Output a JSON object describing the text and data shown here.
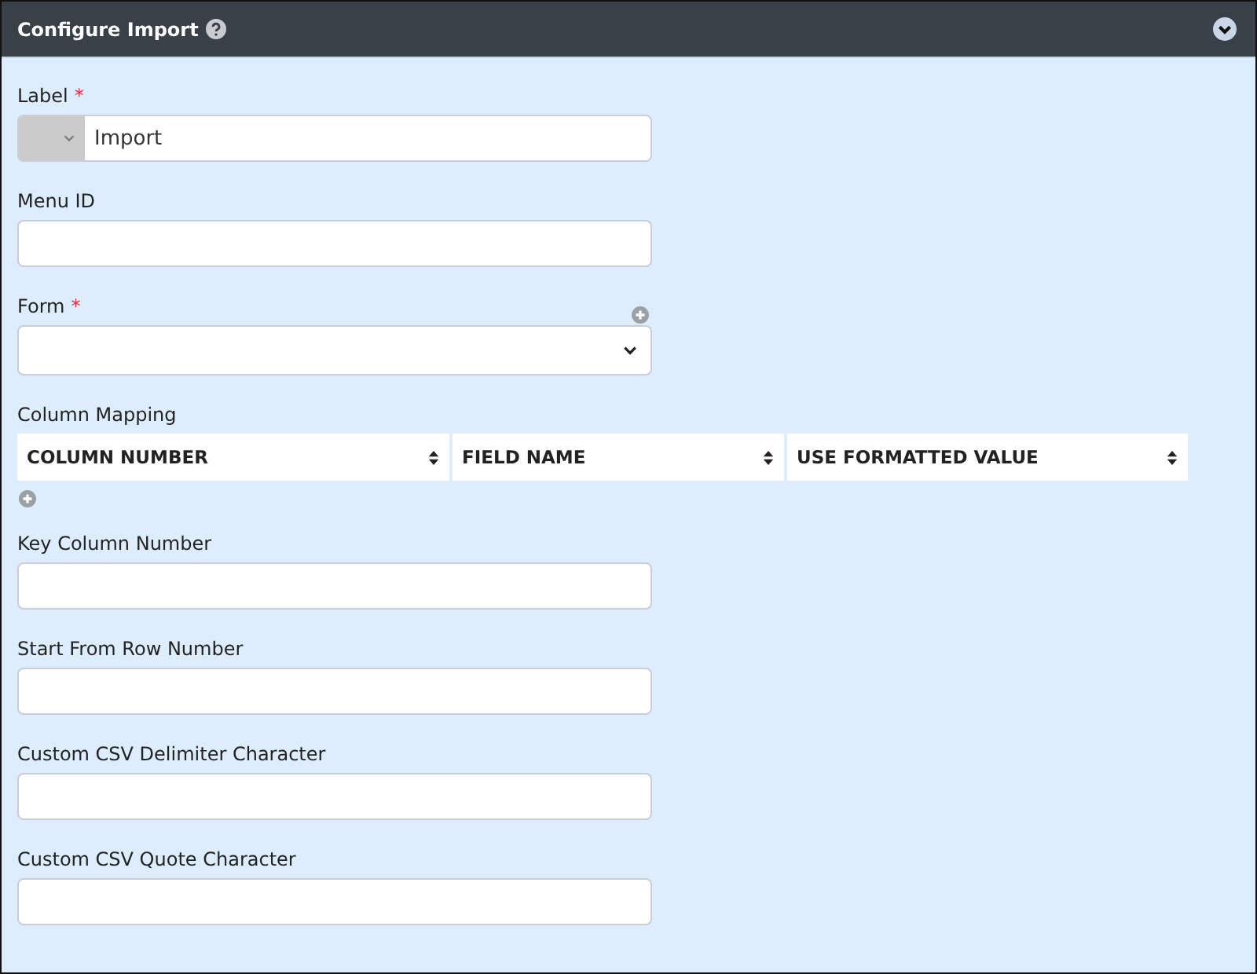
{
  "panel": {
    "title": "Configure Import"
  },
  "sections": [
    {
      "kind": "prefixed",
      "label": "Label",
      "required_mark": "*",
      "value": "Import"
    },
    {
      "kind": "text",
      "label": "Menu ID"
    },
    {
      "kind": "select",
      "label": "Form",
      "required_mark": "*",
      "add_button": true
    },
    {
      "kind": "table",
      "label": "Column Mapping",
      "columns": [
        "COLUMN NUMBER",
        "FIELD NAME",
        "USE FORMATTED VALUE"
      ],
      "add_button": true
    },
    {
      "kind": "text",
      "label": "Key Column Number"
    },
    {
      "kind": "text",
      "label": "Start From Row Number"
    },
    {
      "kind": "text",
      "label": "Custom CSV Delimiter Character"
    },
    {
      "kind": "text",
      "label": "Custom CSV Quote Character"
    }
  ]
}
